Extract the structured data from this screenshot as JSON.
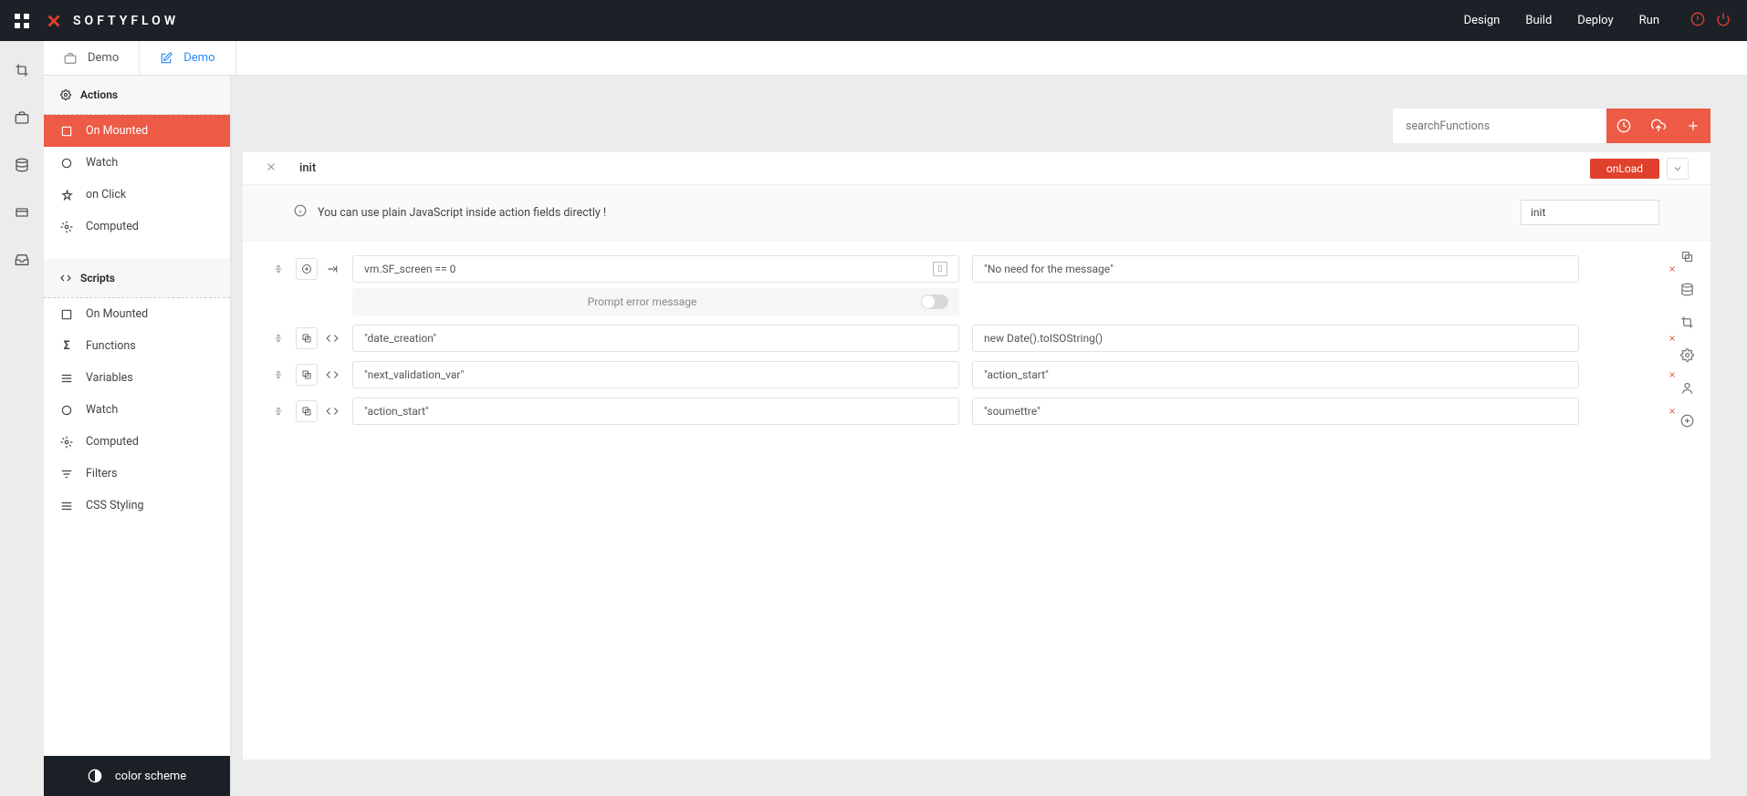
{
  "brand": "SOFTYFLOW",
  "nav": {
    "design": "Design",
    "build": "Build",
    "deploy": "Deploy",
    "run": "Run"
  },
  "tabs": {
    "demo1": "Demo",
    "demo2": "Demo"
  },
  "sidebar": {
    "actions_header": "Actions",
    "actions": {
      "on_mounted": "On Mounted",
      "watch": "Watch",
      "on_click": "on Click",
      "computed": "Computed"
    },
    "scripts_header": "Scripts",
    "scripts": {
      "on_mounted": "On Mounted",
      "functions": "Functions",
      "variables": "Variables",
      "watch": "Watch",
      "computed": "Computed",
      "filters": "Filters",
      "css_styling": "CSS Styling"
    },
    "color_scheme": "color scheme"
  },
  "toolbar": {
    "search_placeholder": "searchFunctions"
  },
  "panel": {
    "title": "init",
    "onload_label": "onLoad",
    "info_text": "You can use plain JavaScript inside action fields directly !",
    "name_value": "init",
    "rows": [
      {
        "left": "vm.SF_screen == 0",
        "right": "\"No need for the message\"",
        "toggle_label": "Prompt error message",
        "has_toggle": true
      },
      {
        "left": "\"date_creation\"",
        "right": "new Date().toISOString()"
      },
      {
        "left": "\"next_validation_var\"",
        "right": "\"action_start\""
      },
      {
        "left": "\"action_start\"",
        "right": "\"soumettre\""
      }
    ]
  }
}
